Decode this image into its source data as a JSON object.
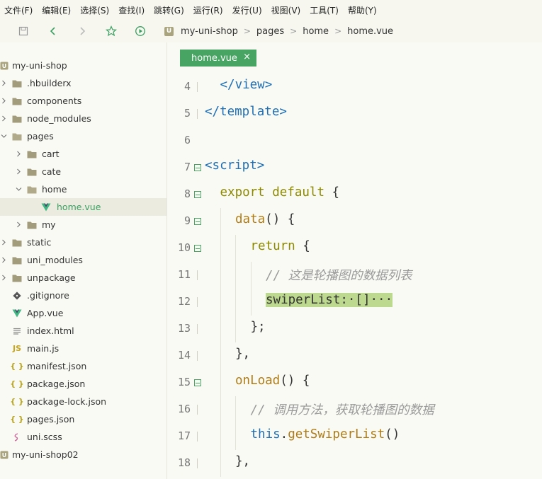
{
  "menu": [
    "文件(F)",
    "编辑(E)",
    "选择(S)",
    "查找(I)",
    "跳转(G)",
    "运行(R)",
    "发行(U)",
    "视图(V)",
    "工具(T)",
    "帮助(Y)"
  ],
  "breadcrumb": {
    "project": "my-uni-shop",
    "folder": "pages",
    "subfolder": "home",
    "file": "home.vue",
    "badge": "U"
  },
  "tree": [
    {
      "label": "my-uni-shop",
      "type": "project",
      "icon": "project-icon"
    },
    {
      "label": ".hbuilderx",
      "type": "folder",
      "icon": "folder-icon"
    },
    {
      "label": "components",
      "type": "folder",
      "icon": "folder-icon"
    },
    {
      "label": "node_modules",
      "type": "folder",
      "icon": "folder-icon"
    },
    {
      "label": "pages",
      "type": "folder-open",
      "icon": "folder-open-icon"
    },
    {
      "label": "cart",
      "type": "folder",
      "icon": "folder-icon"
    },
    {
      "label": "cate",
      "type": "folder",
      "icon": "folder-icon"
    },
    {
      "label": "home",
      "type": "folder-open",
      "icon": "folder-open-icon"
    },
    {
      "label": "home.vue",
      "type": "vue",
      "icon": "vue-file-icon"
    },
    {
      "label": "my",
      "type": "folder",
      "icon": "folder-icon"
    },
    {
      "label": "static",
      "type": "folder",
      "icon": "folder-icon"
    },
    {
      "label": "uni_modules",
      "type": "folder",
      "icon": "folder-icon"
    },
    {
      "label": "unpackage",
      "type": "folder",
      "icon": "folder-icon"
    },
    {
      "label": ".gitignore",
      "type": "git",
      "icon": "git-file-icon"
    },
    {
      "label": "App.vue",
      "type": "vue",
      "icon": "vue-file-icon"
    },
    {
      "label": "index.html",
      "type": "html",
      "icon": "html-file-icon"
    },
    {
      "label": "main.js",
      "type": "js",
      "icon": "js-file-icon",
      "icon_text": "JS"
    },
    {
      "label": "manifest.json",
      "type": "json",
      "icon": "json-file-icon",
      "icon_text": "{ }"
    },
    {
      "label": "package.json",
      "type": "json",
      "icon": "json-file-icon",
      "icon_text": "{ }"
    },
    {
      "label": "package-lock.json",
      "type": "json",
      "icon": "json-file-icon",
      "icon_text": "{ }"
    },
    {
      "label": "pages.json",
      "type": "json",
      "icon": "json-file-icon",
      "icon_text": "{ }"
    },
    {
      "label": "uni.scss",
      "type": "scss",
      "icon": "scss-file-icon"
    },
    {
      "label": "my-uni-shop02",
      "type": "project",
      "icon": "project-icon"
    }
  ],
  "tab": {
    "label": "home.vue",
    "close": "×"
  },
  "code": [
    {
      "ln": "4",
      "fold": false,
      "tokens": [
        [
          "tag",
          "</view>"
        ]
      ]
    },
    {
      "ln": "5",
      "fold": false,
      "tokens": [
        [
          "tag",
          "</template>"
        ]
      ]
    },
    {
      "ln": "6",
      "fold": false,
      "tokens": []
    },
    {
      "ln": "7",
      "fold": true,
      "tokens": [
        [
          "tag",
          "<script>"
        ]
      ]
    },
    {
      "ln": "8",
      "fold": true,
      "tokens": [
        [
          "kw",
          "export default"
        ],
        [
          "txt",
          " {"
        ]
      ]
    },
    {
      "ln": "9",
      "fold": true,
      "tokens": [
        [
          "fn",
          "data"
        ],
        [
          "txt",
          "() {"
        ]
      ]
    },
    {
      "ln": "10",
      "fold": true,
      "tokens": [
        [
          "kw",
          "return"
        ],
        [
          "txt",
          " {"
        ]
      ]
    },
    {
      "ln": "11",
      "fold": false,
      "tokens": [
        [
          "cm",
          "// 这是轮播图的数据列表"
        ]
      ]
    },
    {
      "ln": "12",
      "fold": false,
      "tokens": [
        [
          "hl",
          "swiperList:·[]···"
        ]
      ]
    },
    {
      "ln": "13",
      "fold": false,
      "tokens": [
        [
          "txt",
          "};"
        ]
      ]
    },
    {
      "ln": "14",
      "fold": false,
      "tokens": [
        [
          "txt",
          "},"
        ]
      ]
    },
    {
      "ln": "15",
      "fold": true,
      "tokens": [
        [
          "fn",
          "onLoad"
        ],
        [
          "txt",
          "() {"
        ]
      ]
    },
    {
      "ln": "16",
      "fold": false,
      "tokens": [
        [
          "cm",
          "// 调用方法，获取轮播图的数据"
        ]
      ]
    },
    {
      "ln": "17",
      "fold": false,
      "tokens": [
        [
          "this",
          "this"
        ],
        [
          "txt",
          "."
        ],
        [
          "fn",
          "getSwiperList"
        ],
        [
          "txt",
          "()"
        ]
      ]
    },
    {
      "ln": "18",
      "fold": false,
      "tokens": [
        [
          "txt",
          "},"
        ]
      ]
    }
  ],
  "colors": {
    "accent": "#48a463",
    "tag": "#1e6fb6",
    "keyword": "#8d8a00",
    "function": "#b07c16",
    "comment": "#999999",
    "highlight": "#bcd98f"
  }
}
